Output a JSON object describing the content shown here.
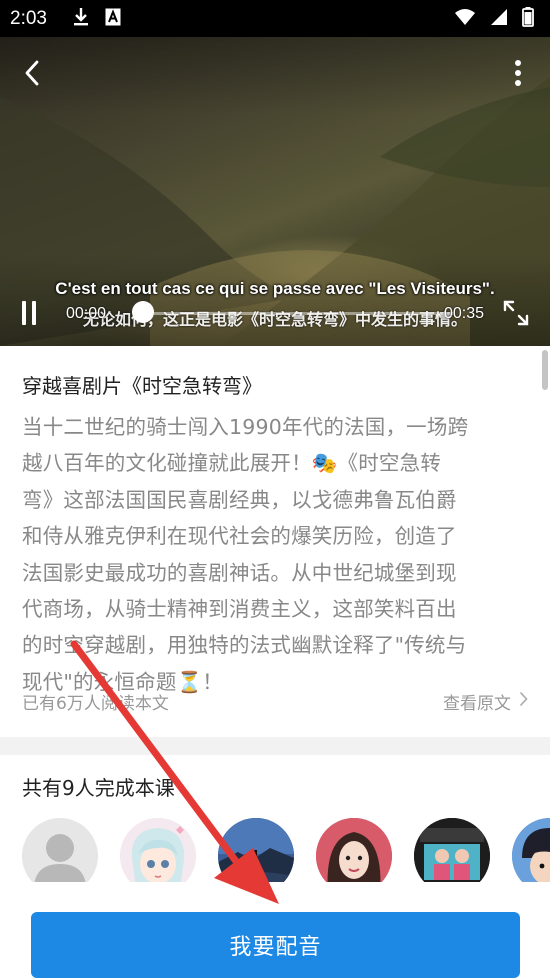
{
  "status_bar": {
    "time": "2:03",
    "icons": [
      "download-icon",
      "text-a-icon",
      "wifi-icon",
      "signal-icon",
      "battery-icon"
    ]
  },
  "video": {
    "subtitle_fr": "C'est en tout cas ce qui se passe avec \"Les Visiteurs\".",
    "subtitle_cn": "无论如何，这正是电影《时空急转弯》中发生的事情。",
    "current_time": "00:00",
    "total_time": "00:35",
    "progress": 0.0
  },
  "article": {
    "title": "穿越喜剧片《时空急转弯》",
    "body_lines": [
      "当十二世纪的骑士闯入1990年代的法国，一场跨",
      "越八百年的文化碰撞就此展开！🎭《时空急转",
      "弯》这部法国国民喜剧经典，以戈德弗鲁瓦伯爵",
      "和侍从雅克伊利在现代社会的爆笑历险，创造了",
      "法国影史最成功的喜剧神话。从中世纪城堡到现",
      "代商场，从骑士精神到消费主义，这部笑料百出",
      "的时空穿越剧，用独特的法式幽默诠释了\"传统与",
      "现代\"的永恒命题⏳！"
    ],
    "read_count": "已有6万人阅读本文",
    "view_original": "查看原文"
  },
  "completed": {
    "title": "共有9人完成本课",
    "avatars": [
      "default-avatar",
      "anime-girl-avatar",
      "landscape-avatar",
      "girl-photo-avatar",
      "group-photo-avatar",
      "cartoon-boy-avatar"
    ]
  },
  "action": {
    "dub_label": "我要配音"
  },
  "colors": {
    "accent": "#1e88e5",
    "annotation_arrow": "#e53935"
  }
}
